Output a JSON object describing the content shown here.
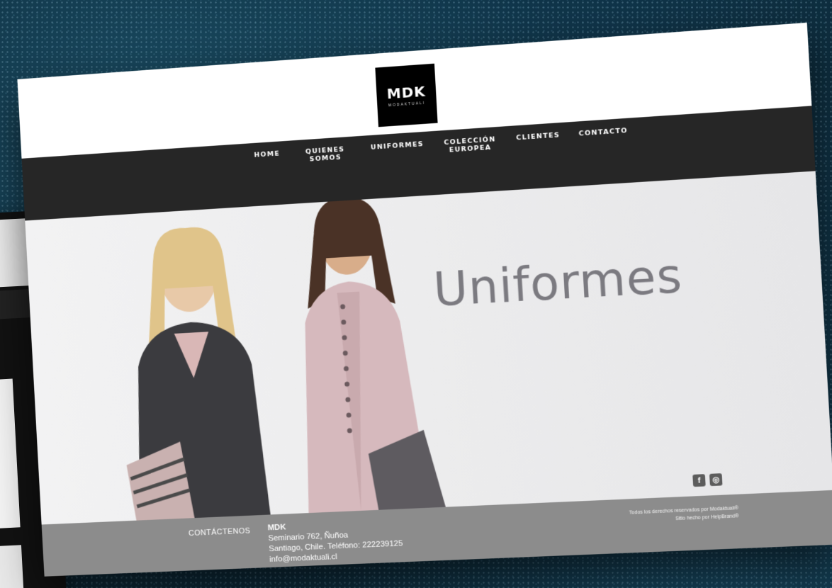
{
  "brand": {
    "logo_main": "MDK",
    "logo_sub": "MODAKTUALI"
  },
  "nav": {
    "items": [
      {
        "label": "HOME"
      },
      {
        "label": "QUIENES SOMOS"
      },
      {
        "label": "UNIFORMES"
      },
      {
        "label": "COLECCIÓN EUROPEA"
      },
      {
        "label": "CLIENTES"
      },
      {
        "label": "CONTACTO"
      }
    ]
  },
  "hero": {
    "title": "Uniformes"
  },
  "footer": {
    "contact_label": "CONTÁCTENOS",
    "company": "MDK",
    "address_line1": "Seminario 762, Ñuñoa",
    "address_line2": "Santiago, Chile. Teléfono: 222239125",
    "email": "info@modaktuali.cl",
    "rights_line1": "Todos los derechos reservados por Modaktuali®",
    "rights_line2": "Sitio hecho por HelpBrand®",
    "social_icons": [
      "facebook-icon",
      "instagram-icon"
    ]
  },
  "colors": {
    "nav_bg": "#262626",
    "footer_bg": "#8c8c8c",
    "hero_text": "#7b7a80",
    "logo_bg": "#000000"
  }
}
